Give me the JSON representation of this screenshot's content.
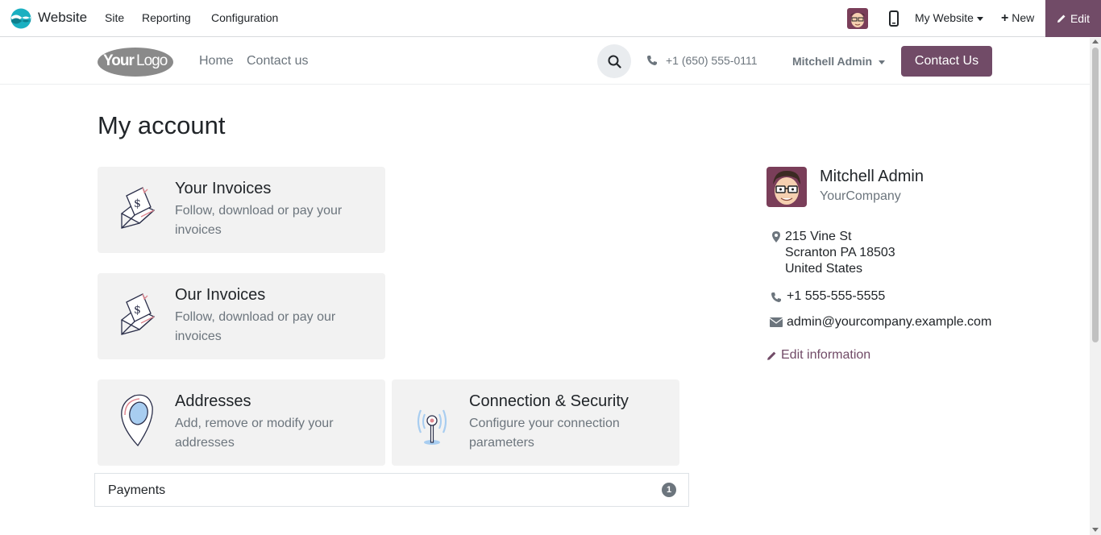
{
  "topbar": {
    "app_name": "Website",
    "menus": [
      "Site",
      "Reporting",
      "Configuration"
    ],
    "my_website": "My Website",
    "new_label": "New",
    "edit_label": "Edit"
  },
  "header": {
    "logo_text": "YourLogo",
    "nav": [
      "Home",
      "Contact us"
    ],
    "phone": "+1 (650) 555-0111",
    "user": "Mitchell Admin",
    "contact_button": "Contact Us"
  },
  "main": {
    "title": "My account",
    "cards": [
      {
        "title": "Your Invoices",
        "desc": "Follow, download or pay your invoices",
        "icon": "invoice-envelope-icon"
      },
      {
        "title": "Our Invoices",
        "desc": "Follow, download or pay our invoices",
        "icon": "invoice-envelope-icon"
      },
      {
        "title": "Addresses",
        "desc": "Add, remove or modify your addresses",
        "icon": "map-pin-icon"
      },
      {
        "title": "Connection & Security",
        "desc": "Configure your connection parameters",
        "icon": "antenna-icon"
      }
    ],
    "payments": {
      "label": "Payments",
      "count": "1"
    }
  },
  "sidebar": {
    "name": "Mitchell Admin",
    "company": "YourCompany",
    "address": [
      "215 Vine St",
      "Scranton PA 18503",
      "United States"
    ],
    "phone": "+1 555-555-5555",
    "email": "admin@yourcompany.example.com",
    "edit_label": "Edit information"
  },
  "colors": {
    "brand": "#714b67",
    "muted": "#6c757d",
    "card_bg": "#f2f2f2"
  }
}
